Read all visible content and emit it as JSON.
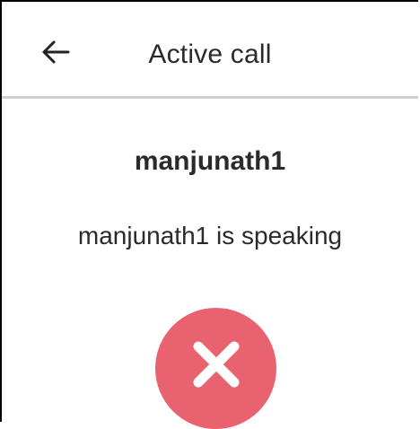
{
  "header": {
    "back_icon": "arrow-left-icon",
    "title": "Active call"
  },
  "call": {
    "caller_name": "manjunath1",
    "status": "manjunath1 is speaking",
    "end_call_icon": "close-icon",
    "end_call_color": "#e8636f"
  },
  "colors": {
    "background": "#ffffff",
    "text": "#2a2a2a",
    "divider": "#cfcfcf",
    "end_call": "#e8636f"
  }
}
